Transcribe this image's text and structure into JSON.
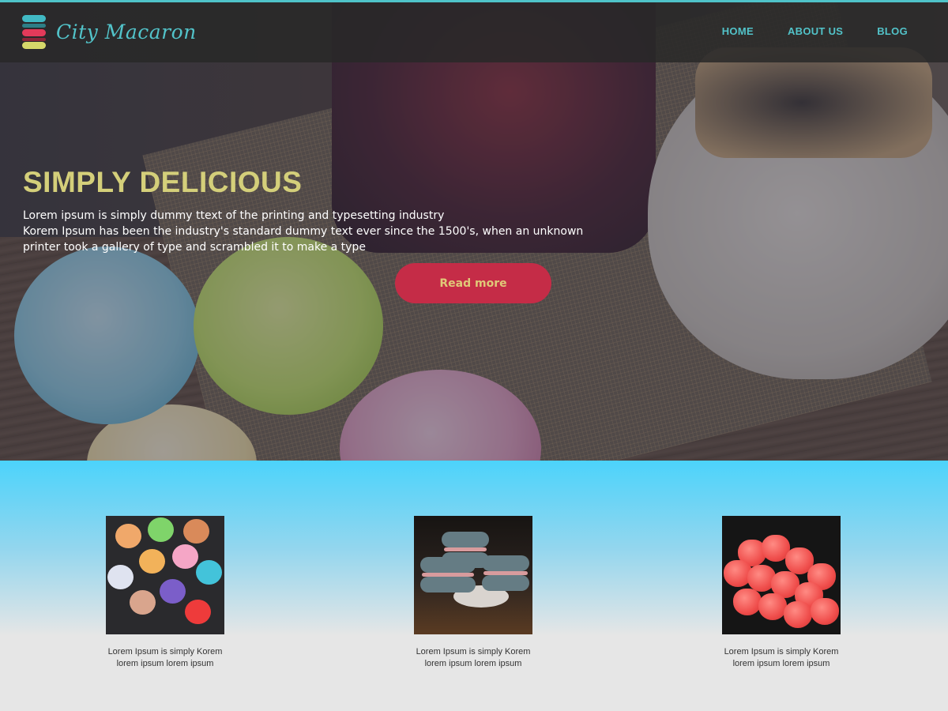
{
  "header": {
    "logo_text": "City Macaron",
    "nav": [
      {
        "label": "HOME"
      },
      {
        "label": "ABOUT US"
      },
      {
        "label": "BLOG"
      }
    ]
  },
  "hero": {
    "title": "SIMPLY DELICIOUS",
    "lines": [
      "Lorem ipsum is simply dummy ttext of the printing and typesetting industry",
      "Korem Ipsum has been the industry's standard dummy text ever since the 1500's, when an unknown",
      "printer took a gallery of type and scrambled it to make a type"
    ],
    "button_label": "Read more"
  },
  "features": [
    {
      "caption_line1": "Lorem Ipsum is simply Korem",
      "caption_line2": "lorem ipsum lorem ipsum"
    },
    {
      "caption_line1": "Lorem Ipsum is simply Korem",
      "caption_line2": "lorem ipsum lorem ipsum"
    },
    {
      "caption_line1": "Lorem Ipsum is simply Korem",
      "caption_line2": "lorem ipsum lorem ipsum"
    }
  ],
  "colors": {
    "accent_teal": "#52c3c9",
    "title_yellow": "#d4cf7a",
    "button_red": "#c52c47",
    "features_top": "#4cd3fb",
    "page_bg": "#e6e6e6"
  }
}
